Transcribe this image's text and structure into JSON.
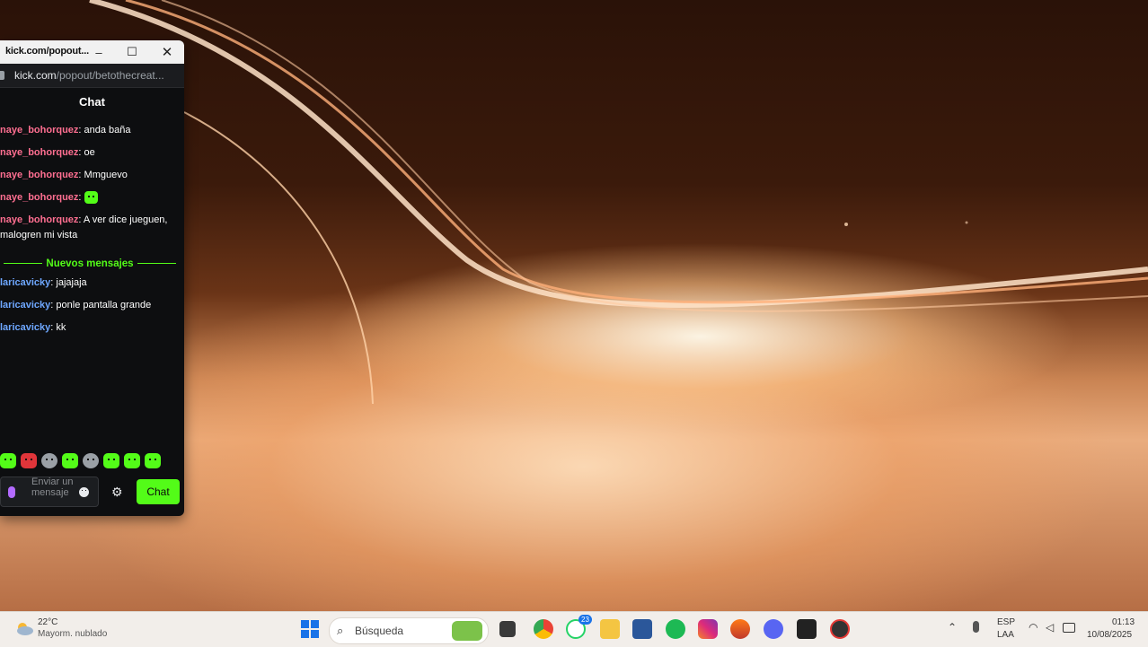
{
  "popout": {
    "title": "kick.com/popout...",
    "url_domain": "kick.com",
    "url_path": "/popout/betothecreat...",
    "chat_header": "Chat",
    "messages": [
      {
        "user": "naye_bohorquez",
        "sep": ":",
        "text": " anda baña",
        "color": "pink"
      },
      {
        "user": "naye_bohorquez",
        "sep": ":",
        "text": " oe",
        "color": "pink"
      },
      {
        "user": "naye_bohorquez",
        "sep": ":",
        "text": " Mmguevo",
        "color": "pink"
      },
      {
        "user": "naye_bohorquez",
        "sep": ":",
        "text": "",
        "color": "pink",
        "emote": "green-emote"
      },
      {
        "user": "naye_bohorquez",
        "sep": ":",
        "text": " A ver dice jueguen, malogren mi vista",
        "color": "pink"
      }
    ],
    "new_messages_label": "Nuevos mensajes",
    "new_messages": [
      {
        "user": "laricavicky",
        "sep": ":",
        "text": " jajajaja",
        "color": "blue"
      },
      {
        "user": "laricavicky",
        "sep": ":",
        "text": " ponle pantalla grande",
        "color": "blue"
      },
      {
        "user": "laricavicky",
        "sep": ":",
        "text": " kk",
        "color": "blue"
      }
    ],
    "input_placeholder": "Enviar un mensaje",
    "send_label": "Chat"
  },
  "taskbar": {
    "weather_temp": "22°C",
    "weather_desc": "Mayorm. nublado",
    "search_placeholder": "Búsqueda",
    "whatsapp_badge": "23",
    "lang_line1": "ESP",
    "lang_line2": "LAA",
    "time": "01:13",
    "date": "10/08/2025",
    "apps": [
      "windows-start-icon",
      "file-explorer-icon",
      "chrome-icon",
      "whatsapp-icon",
      "folder-icon",
      "word-icon",
      "spotify-icon",
      "instagram-icon",
      "brave-icon",
      "discord-icon",
      "live-app-icon",
      "record-app-icon"
    ]
  },
  "colors": {
    "kick_green": "#53fc18",
    "user_pink": "#ff6f91",
    "user_blue": "#6ea7ff",
    "chat_bg": "#0d0e10"
  }
}
